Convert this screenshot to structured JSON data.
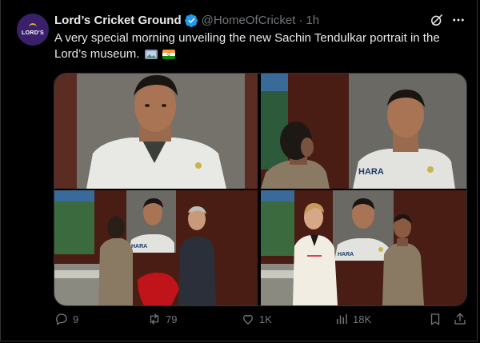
{
  "tweet": {
    "account_logo_text": "LORD'S",
    "display_name": "Lord’s Cricket Ground",
    "handle": "@HomeOfCricket",
    "separator": "·",
    "time": "1h",
    "text": "A very special morning unveiling the new Sachin Tendulkar portrait in the Lord’s museum.",
    "emojis": [
      "framed-picture-emoji",
      "india-flag-emoji"
    ],
    "shirt_sponsor_text": "HARA",
    "media": [
      {
        "id": "photo-1",
        "subject": "portrait close-up"
      },
      {
        "id": "photo-2",
        "subject": "man viewing portrait"
      },
      {
        "id": "photo-3",
        "subject": "unveiling with red cloth"
      },
      {
        "id": "photo-4",
        "subject": "two men posing beside portrait"
      }
    ]
  },
  "actions": {
    "replies": "9",
    "reposts": "79",
    "likes": "1K",
    "views": "18K"
  },
  "colors": {
    "background": "#000000",
    "text": "#e7e9ea",
    "muted": "#71767b",
    "verified": "#1d9bf0",
    "avatar": "#3a1f6b"
  }
}
